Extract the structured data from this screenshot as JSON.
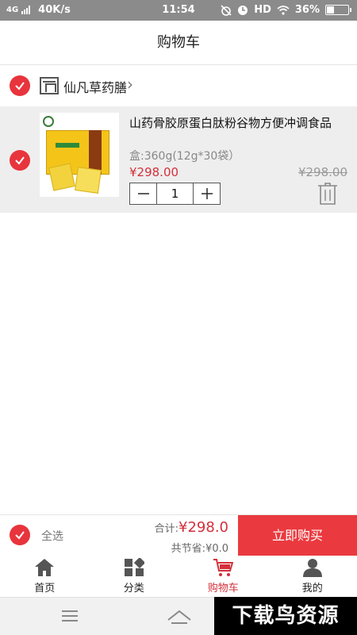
{
  "status": {
    "network": "4G",
    "speed": "40K/s",
    "time": "11:54",
    "hd": "HD",
    "battery": "36%",
    "battery_level": 0.36
  },
  "header": {
    "title": "购物车"
  },
  "shop": {
    "name": "仙凡草药膳"
  },
  "item": {
    "name": "山药骨胶原蛋白肽粉谷物方便冲调食品",
    "spec": "盒:360g(12g*30袋）",
    "price": "¥298.00",
    "original_price": "¥298.00",
    "quantity": "1"
  },
  "bottom": {
    "select_all": "全选",
    "total_label": "合计:",
    "total": "¥298.0",
    "saved": "共节省:¥0.0",
    "buy_button": "立即购买"
  },
  "tabs": [
    {
      "label": "首页",
      "icon": "home-icon"
    },
    {
      "label": "分类",
      "icon": "category-icon"
    },
    {
      "label": "购物车",
      "icon": "cart-icon",
      "active": true
    },
    {
      "label": "我的",
      "icon": "user-icon"
    }
  ],
  "watermark": "下载鸟资源",
  "colors": {
    "accent": "#e8343c",
    "price": "#d3303a",
    "buy": "#ea3a3f"
  }
}
